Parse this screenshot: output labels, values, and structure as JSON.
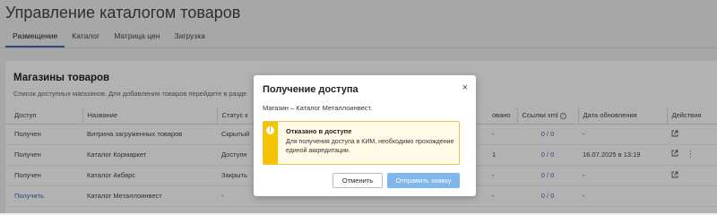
{
  "page": {
    "title": "Управление каталогом товаров"
  },
  "tabs": [
    {
      "label": "Размещение"
    },
    {
      "label": "Каталог"
    },
    {
      "label": "Матрица цен"
    },
    {
      "label": "Загрузка"
    }
  ],
  "card": {
    "title": "Магазины товаров",
    "description": "Список доступных магазинов. Для добавления товаров перейдите в разде"
  },
  "table": {
    "headers": [
      "Доступ",
      "Название",
      "Статус к",
      "",
      "овано",
      "Ссылки xml",
      "Дата обновления",
      "Действия"
    ],
    "rows": [
      {
        "access": "Получен",
        "name": "Витрина загруженных товаров",
        "status": "Скрытый",
        "published": "-",
        "links": "0 / 0",
        "date": "-"
      },
      {
        "access": "Получен",
        "name": "Каталог Кормаркет",
        "status": "Доступн",
        "published": "1",
        "links": "0 / 0",
        "date": "16.07.2025 в 13:19"
      },
      {
        "access": "Получен",
        "name": "Каталог Акбарс",
        "status": "Закрыть",
        "published": "-",
        "links": "0 / 0",
        "date": "-"
      },
      {
        "access": "Получить",
        "name": "Каталог Металлоинвест",
        "status": "-",
        "published": "-",
        "links": "0 / 0",
        "date": "-"
      }
    ]
  },
  "modal": {
    "title": "Получение доступа",
    "close": "×",
    "store_text": "Магазин – Каталог Металлоинвест.",
    "alert": {
      "icon": "!",
      "title": "Отказано в доступе",
      "text": "Для получения доступа в КИМ, необходимо прохождение единой аккредитации."
    },
    "cancel_label": "Отменить",
    "submit_label": "Отправить заявку"
  }
}
